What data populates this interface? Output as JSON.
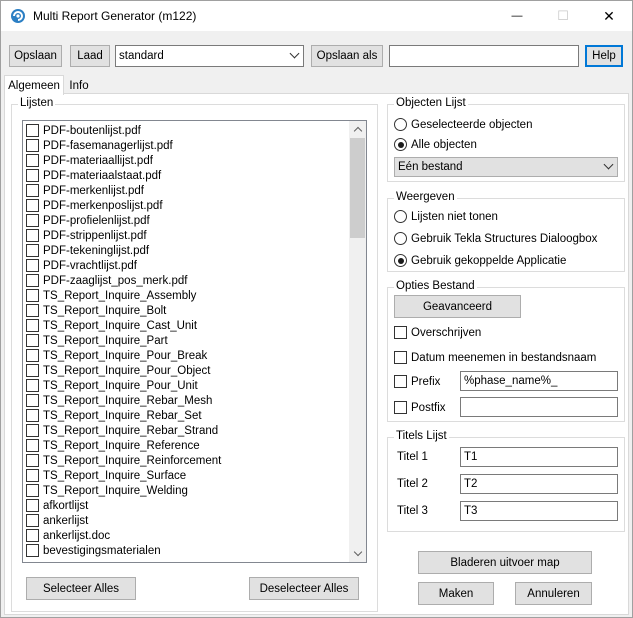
{
  "window": {
    "title": "Multi Report Generator (m122)",
    "minimize": "—",
    "maximize": "☐",
    "close": "✕"
  },
  "toolbar": {
    "save_label": "Opslaan",
    "load_label": "Laad",
    "preset_value": "standard",
    "save_as_label": "Opslaan als",
    "save_as_input_value": "",
    "help_label": "Help"
  },
  "tabs": [
    {
      "label": "Algemeen",
      "active": true
    },
    {
      "label": "Info",
      "active": false
    }
  ],
  "lists_group": {
    "title": "Lijsten",
    "items": [
      "PDF-boutenlijst.pdf",
      "PDF-fasemanagerlijst.pdf",
      "PDF-materiaallijst.pdf",
      "PDF-materiaalstaat.pdf",
      "PDF-merkenlijst.pdf",
      "PDF-merkenposlijst.pdf",
      "PDF-profielenlijst.pdf",
      "PDF-strippenlijst.pdf",
      "PDF-tekeninglijst.pdf",
      "PDF-vrachtlijst.pdf",
      "PDF-zaaglijst_pos_merk.pdf",
      "TS_Report_Inquire_Assembly",
      "TS_Report_Inquire_Bolt",
      "TS_Report_Inquire_Cast_Unit",
      "TS_Report_Inquire_Part",
      "TS_Report_Inquire_Pour_Break",
      "TS_Report_Inquire_Pour_Object",
      "TS_Report_Inquire_Pour_Unit",
      "TS_Report_Inquire_Rebar_Mesh",
      "TS_Report_Inquire_Rebar_Set",
      "TS_Report_Inquire_Rebar_Strand",
      "TS_Report_Inquire_Reference",
      "TS_Report_Inquire_Reinforcement",
      "TS_Report_Inquire_Surface",
      "TS_Report_Inquire_Welding",
      "afkortlijst",
      "ankerlijst",
      "ankerlijst.doc",
      "bevestigingsmaterialen"
    ],
    "select_all_label": "Selecteer Alles",
    "deselect_all_label": "Deselecteer Alles"
  },
  "objects_group": {
    "title": "Objecten Lijst",
    "options": [
      {
        "label": "Geselecteerde objecten",
        "checked": false
      },
      {
        "label": "Alle objecten",
        "checked": true
      }
    ],
    "file_mode_value": "Eén bestand"
  },
  "display_group": {
    "title": "Weergeven",
    "options": [
      {
        "label": "Lijsten niet tonen",
        "checked": false
      },
      {
        "label": "Gebruik Tekla Structures Dialoogbox",
        "checked": false
      },
      {
        "label": "Gebruik gekoppelde Applicatie",
        "checked": true
      }
    ]
  },
  "file_options_group": {
    "title": "Opties Bestand",
    "advanced_label": "Geavanceerd",
    "overwrite_label": "Overschrijven",
    "date_label": "Datum meenemen in bestandsnaam",
    "prefix_label": "Prefix",
    "prefix_value": "%phase_name%_",
    "postfix_label": "Postfix",
    "postfix_value": ""
  },
  "titles_group": {
    "title": "Titels Lijst",
    "rows": [
      {
        "label": "Titel 1",
        "value": "T1"
      },
      {
        "label": "Titel 2",
        "value": "T2"
      },
      {
        "label": "Titel 3",
        "value": "T3"
      }
    ]
  },
  "actions": {
    "browse_label": "Bladeren uitvoer map",
    "make_label": "Maken",
    "cancel_label": "Annuleren"
  },
  "colors": {
    "accent": "#0078d7",
    "icon": "#2b7fc4"
  }
}
